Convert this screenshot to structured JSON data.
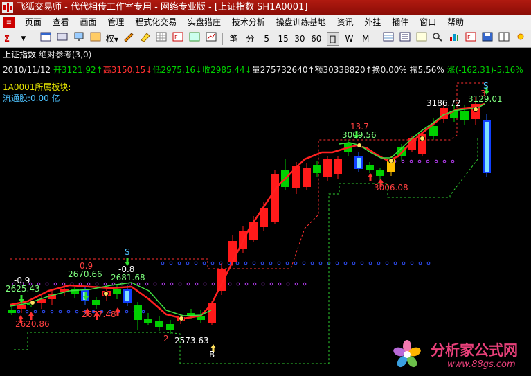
{
  "window": {
    "title": "飞狐交易师 - 代代相传工作室专用 - 网络专业版 - [上证指数 SH1A0001]"
  },
  "menu": [
    "页面",
    "查看",
    "画面",
    "管理",
    "程式化交易",
    "实盘猎庄",
    "技术分析",
    "操盘训练基地",
    "资讯",
    "外挂",
    "插件",
    "窗口",
    "帮助"
  ],
  "toolbar": {
    "quan_label": "权",
    "periods": [
      "笔",
      "分",
      "5",
      "15",
      "30",
      "60",
      "日",
      "W",
      "M"
    ]
  },
  "chart": {
    "indicator_name": "上证指数",
    "indicator_params": "绝对参考(3,0)",
    "quote": {
      "date": "2010/11/12",
      "open": "开3121.92↑",
      "high": "高3150.15↓",
      "low": "低2975.16↓",
      "close": "收2985.44↓",
      "volume": "量275732640↑",
      "amount": "额30338820↑",
      "turnover": "换0.00%",
      "amplitude": "振5.56%",
      "change": "涨(-162.31)-5.16%"
    },
    "block_label": "1A0001所属板块:",
    "float_label": "流通股:0.00 亿",
    "annotations": {
      "a1": "-0.9",
      "a2": "2625.43",
      "a3": "2620.86",
      "a4": "0.9",
      "a5": "2670.66",
      "a6": "-0.8",
      "a7": "2681.68",
      "a8": "2677.48",
      "a9": "2573.63",
      "a10": "13.7",
      "a11": "3009.56",
      "a12": "3006.08",
      "a13": "3186.72",
      "a14": "3129.01",
      "s1": "S",
      "s2": "S",
      "b1": "B",
      "r1": "2",
      "r2": "3"
    }
  },
  "watermark": {
    "name": "分析家公式网",
    "url": "www.88gs.com"
  }
}
